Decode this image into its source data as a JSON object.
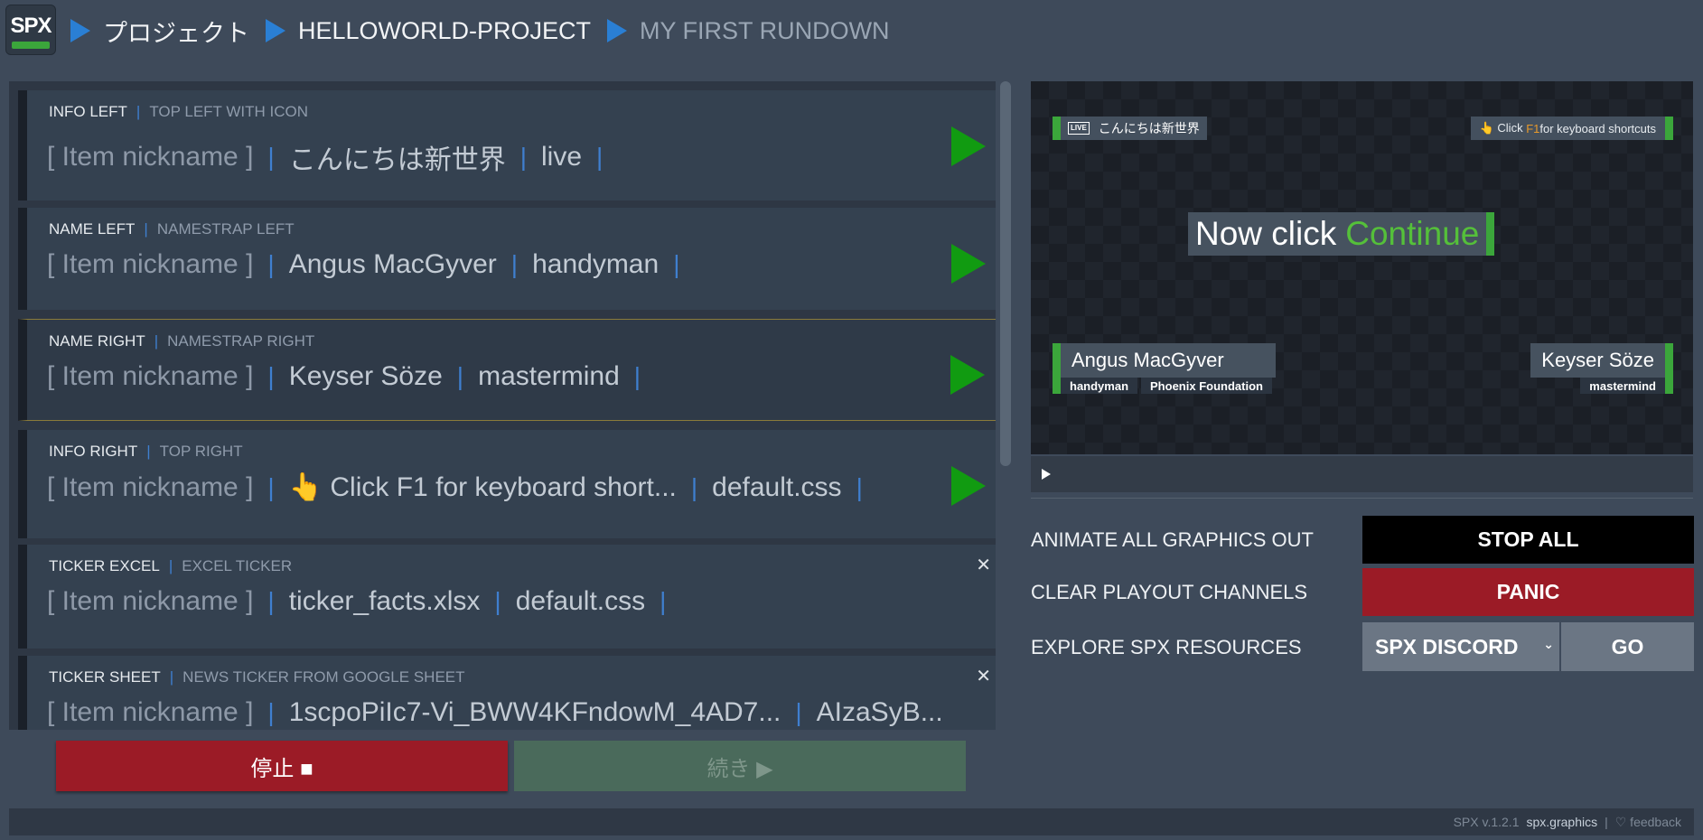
{
  "app": {
    "logo_text": "SPX"
  },
  "breadcrumbs": [
    "プロジェクト",
    "HELLOWORLD-PROJECT",
    "MY FIRST RUNDOWN"
  ],
  "rundown": {
    "items": [
      {
        "title": "INFO LEFT",
        "subtitle": "TOP LEFT WITH ICON",
        "nickname": "[ Item nickname ]",
        "fields": [
          "こんにちは新世界",
          "live"
        ]
      },
      {
        "title": "NAME LEFT",
        "subtitle": "NAMESTRAP LEFT",
        "nickname": "[ Item nickname ]",
        "fields": [
          "Angus MacGyver",
          "handyman"
        ]
      },
      {
        "title": "NAME RIGHT",
        "subtitle": "NAMESTRAP RIGHT",
        "nickname": "[ Item nickname ]",
        "fields": [
          "Keyser Söze",
          "mastermind"
        ]
      },
      {
        "title": "INFO RIGHT",
        "subtitle": "TOP RIGHT",
        "nickname": "[ Item nickname ]",
        "fields": [
          "👆 Click F1 for keyboard short...",
          "default.css"
        ]
      },
      {
        "title": "TICKER EXCEL",
        "subtitle": "EXCEL TICKER",
        "nickname": "[ Item nickname ]",
        "fields": [
          "ticker_facts.xlsx",
          "default.css"
        ]
      },
      {
        "title": "TICKER SHEET",
        "subtitle": "NEWS TICKER FROM GOOGLE SHEET",
        "nickname": "[ Item nickname ]",
        "fields": [
          "1scpoPiIc7-Vi_BWW4KFndowM_4AD7...",
          "AIzaSyB..."
        ]
      }
    ]
  },
  "buttons": {
    "stop_label": "停止 ■",
    "continue_label": "続き ▶"
  },
  "preview": {
    "live_badge": "LIVE",
    "live_text": "こんにちは新世界",
    "shortcut_prefix": "👆 Click ",
    "shortcut_key": "F1",
    "shortcut_suffix": " for keyboard shortcuts",
    "main_text": "Now click",
    "main_highlight": "Continue",
    "left_name": "Angus MacGyver",
    "left_role": "handyman",
    "left_org": "Phoenix Foundation",
    "right_name": "Keyser Söze",
    "right_role": "mastermind"
  },
  "controls": {
    "animate_label": "ANIMATE ALL GRAPHICS OUT",
    "clear_label": "CLEAR PLAYOUT CHANNELS",
    "explore_label": "EXPLORE SPX RESOURCES",
    "stop_all": "STOP ALL",
    "panic": "PANIC",
    "resource_selected": "SPX DISCORD",
    "go": "GO"
  },
  "footer": {
    "version": "SPX v.1.2.1",
    "site": "spx.graphics",
    "feedback": "♡ feedback"
  },
  "colors": {
    "accent_green": "#3ba63b",
    "play_green": "#119b11",
    "panic_red": "#9b1b26",
    "breadcrumb_blue": "#2a7fd4"
  }
}
